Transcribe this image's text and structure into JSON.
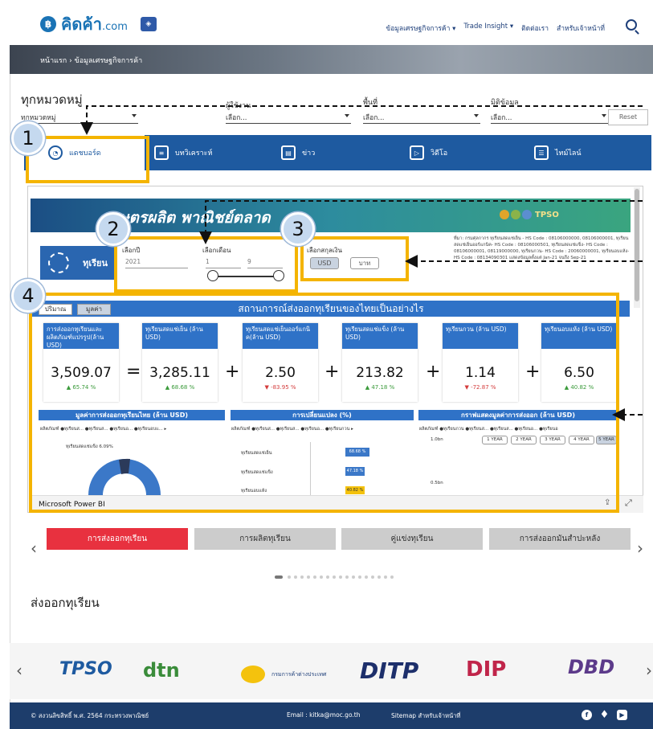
{
  "header": {
    "logo_text": "คิดค้า",
    "logo_suffix": ".com",
    "nav": [
      "ข้อมูลเศรษฐกิจการค้า ▾",
      "Trade Insight ▾",
      "ติดต่อเรา",
      "สำหรับเจ้าหน้าที่"
    ]
  },
  "breadcrumb": "หน้าแรก › ข้อมูลเศรษฐกิจการค้า",
  "filters": {
    "category_title": "ทุกหมวดหมู่",
    "category_value": "ทุกหมวดหมู่",
    "user_label": "ผู้ใช้งาน",
    "user_value": "เลือก...",
    "area_label": "พื้นที่",
    "area_value": "เลือก...",
    "dimension_label": "มิติข้อมูล",
    "dimension_value": "เลือก...",
    "reset": "Reset"
  },
  "tabs": [
    {
      "label": "แดชบอร์ด"
    },
    {
      "label": "บทวิเคราะห์"
    },
    {
      "label": "ข่าว"
    },
    {
      "label": "วิดีโอ"
    },
    {
      "label": "ไทม์ไลน์"
    }
  ],
  "report": {
    "title": "เกษตรผลิต พาณิชย์ตลาด",
    "tpso": "TPSO",
    "fruit": "ทุเรียน",
    "year_label": "เลือกปี",
    "year_value": "2021",
    "month_label": "เลือกเดือน",
    "month_from": "1",
    "month_to": "9",
    "currency_label": "เลือกสกุลเงิน",
    "currency_usd": "USD",
    "currency_baht": "บาท",
    "source": "ที่มา: กรมศุลกากร ทุเรียนสดแช่เย็น - HS Code : 08106000000, 08106000001, ทุเรียนสดแช่เย็นออร์แกนิค- HS Code : 08106000501, ทุเรียนสดแช่แข็ง- HS Code : 08106000001, 08119000000, ทุเรียนกวน- HS Code : 20060000001, ทุเรียนอบแห้ง- HS Code : 08134090301 แสดงข้อมูลตั้งแต่ Jan-21 จนถึง Sep-21",
    "section_title": "สถานการณ์ส่งออกทุเรียนของไทยเป็นอย่างไร",
    "qty_btn": "ปริมาณ",
    "val_btn": "มูลค่า",
    "cards": [
      {
        "title": "การส่งออกทุเรียนและผลิตภัณฑ์แปรรูป(ล้าน USD)",
        "value": "3,509.07",
        "pct": "▲ 65.74 %",
        "dir": "up"
      },
      {
        "title": "ทุเรียนสดแช่เย็น (ล้าน USD)",
        "value": "3,285.11",
        "pct": "▲ 68.68 %",
        "dir": "up"
      },
      {
        "title": "ทุเรียนสดแช่เย็นออร์แกนิค(ล้าน USD)",
        "value": "2.50",
        "pct": "▼ -83.95 %",
        "dir": "down"
      },
      {
        "title": "ทุเรียนสดแช่แข็ง (ล้าน USD)",
        "value": "213.82",
        "pct": "▲ 47.18 %",
        "dir": "up"
      },
      {
        "title": "ทุเรียนกวน (ล้าน USD)",
        "value": "1.14",
        "pct": "▼ -72.87 %",
        "dir": "down"
      },
      {
        "title": "ทุเรียนอบแห้ง (ล้าน USD)",
        "value": "6.50",
        "pct": "▲ 40.82 %",
        "dir": "up"
      }
    ],
    "ops": [
      "=",
      "+",
      "+",
      "+",
      "+"
    ],
    "chart1_title": "มูลค่าการส่งออกทุเรียนไทย (ล้าน USD)",
    "chart2_title": "การเปลี่ยนแปลง (%)",
    "chart3_title": "กราฟแสดงมูลค่าการส่งออก (ล้าน USD)",
    "legend": "ผลิตภัณฑ์ ●ทุเรียนส... ●ทุเรียนส... ●ทุเรียนอ... ●ทุเรียนอบแ... ▸",
    "legend2": "ผลิตภัณฑ์ ●ทุเรียนส... ●ทุเรียนส... ●ทุเรียนอ... ●ทุเรียนกวน ▸",
    "legend3": "ผลิตภัณฑ์ ●ทุเรียนกวน ●ทุเรียนส... ●ทุเรียนส... ●ทุเรียนอ... ●ทุเรียนอ",
    "donut_label": "ทุเรียนสดแช่แข็ง 6.09%",
    "bar_labels": [
      "ทุเรียนสดแช่เย็น",
      "ทุเรียนสดแช่แข็ง",
      "ทุเรียนอบแห้ง"
    ],
    "bar_values": [
      "68.68 %",
      "47.18 %",
      "40.82 %"
    ],
    "years": [
      "1 YEAR",
      "2 YEAR",
      "3 YEAR",
      "4 YEAR",
      "5 YEAR"
    ],
    "axis_top": "1.0bn",
    "axis_mid": "0.5bn",
    "powerbi": "Microsoft Power BI"
  },
  "callouts": [
    "1",
    "2",
    "3",
    "4"
  ],
  "bottom_tabs": [
    "การส่งออกทุเรียน",
    "การผลิตทุเรียน",
    "คู่แข่งทุเรียน",
    "การส่งออกมันสำปะหลัง"
  ],
  "export_title": "ส่งออกทุเรียน",
  "partners": [
    "TPSO",
    "dtn",
    "กรมการค้าต่างประเทศ",
    "DITP",
    "DIP",
    "DBD"
  ],
  "footer": {
    "copyright": "© สงวนลิขสิทธิ์ พ.ศ. 2564 กระทรวงพาณิชย์",
    "email": "Email : kitka@moc.go.th",
    "sitemap": "Sitemap สำหรับเจ้าหน้าที่"
  },
  "colors": {
    "primary": "#1e5aa0",
    "highlight": "#f4b400",
    "accent_red": "#e8313f"
  }
}
